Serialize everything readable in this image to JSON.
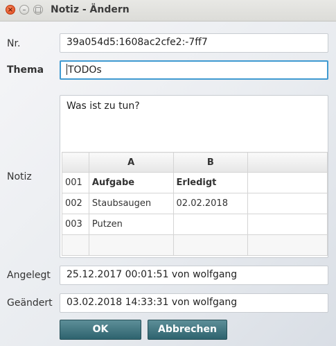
{
  "window": {
    "title": "Notiz - Ändern",
    "controls": {
      "close": "×",
      "minimize": "–",
      "maximize": "□"
    }
  },
  "form": {
    "nr_label": "Nr.",
    "nr_value": "39a054d5:1608ac2cfe2:-7ff7",
    "thema_label": "Thema",
    "thema_value": "TODOs",
    "notiz_label": "Notiz",
    "notiz_text": "Was ist zu tun?",
    "angelegt_label": "Angelegt",
    "angelegt_value": "25.12.2017 00:01:51 von wolfgang",
    "geaendert_label": "Geändert",
    "geaendert_value": "03.02.2018 14:33:31 von wolfgang"
  },
  "table": {
    "headers": [
      "",
      "A",
      "B",
      ""
    ],
    "rows": [
      [
        "001",
        "Aufgabe",
        "Erledigt",
        ""
      ],
      [
        "002",
        "Staubsaugen",
        "02.02.2018",
        ""
      ],
      [
        "003",
        "Putzen",
        "",
        ""
      ],
      [
        "",
        "",
        "",
        ""
      ]
    ]
  },
  "buttons": {
    "ok": "OK",
    "cancel": "Abbrechen"
  }
}
